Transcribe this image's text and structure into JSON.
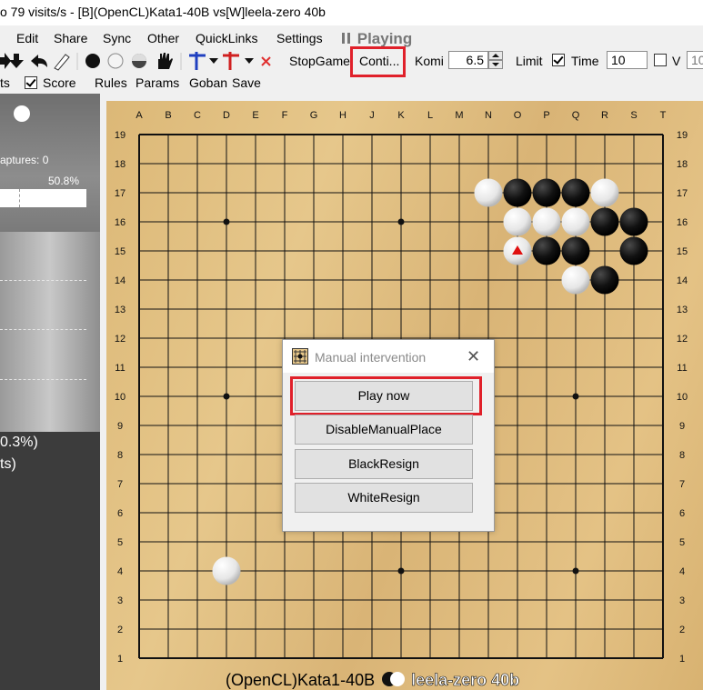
{
  "window": {
    "title": "o 79 visits/s - [B](OpenCL)Kata1-40B vs[W]leela-zero 40b"
  },
  "menu": {
    "items": [
      "Edit",
      "Share",
      "Sync",
      "Other",
      "QuickLinks",
      "Settings"
    ],
    "status": "Playing"
  },
  "toolbar": {
    "stop_game": "StopGame",
    "continue": "Conti...",
    "komi_label": "Komi",
    "komi_value": "6.5",
    "limit_label": "Limit",
    "time_label": "Time",
    "time_value": "10",
    "v_label": "V",
    "v_value": "10",
    "time_checked": true,
    "v_checked": false
  },
  "toolbar2": {
    "items": [
      "ts",
      "Score",
      "Rules",
      "Params",
      "Goban",
      "Save"
    ],
    "score_checked": true
  },
  "left_panel": {
    "captures": "aptures: 0",
    "winrate": "50.8%",
    "stat_line1": "0.3%)",
    "stat_line2": "ts)"
  },
  "board": {
    "columns": [
      "A",
      "B",
      "C",
      "D",
      "E",
      "F",
      "G",
      "H",
      "J",
      "K",
      "L",
      "M",
      "N",
      "O",
      "P",
      "Q",
      "R",
      "S",
      "T"
    ],
    "rows": [
      "19",
      "18",
      "17",
      "16",
      "15",
      "14",
      "13",
      "12",
      "11",
      "10",
      "9",
      "8",
      "7",
      "6",
      "5",
      "4",
      "3",
      "2",
      "1"
    ],
    "hoshi": [
      "D16",
      "K16",
      "D10",
      "Q10",
      "D4",
      "K4",
      "Q4"
    ],
    "stones": [
      {
        "pos": "N17",
        "color": "white"
      },
      {
        "pos": "O17",
        "color": "black"
      },
      {
        "pos": "P17",
        "color": "black"
      },
      {
        "pos": "Q17",
        "color": "black"
      },
      {
        "pos": "R17",
        "color": "white"
      },
      {
        "pos": "O16",
        "color": "white"
      },
      {
        "pos": "P16",
        "color": "white"
      },
      {
        "pos": "Q16",
        "color": "white"
      },
      {
        "pos": "R16",
        "color": "black"
      },
      {
        "pos": "S16",
        "color": "black"
      },
      {
        "pos": "O15",
        "color": "white",
        "last_move": true
      },
      {
        "pos": "P15",
        "color": "black"
      },
      {
        "pos": "Q15",
        "color": "black"
      },
      {
        "pos": "S15",
        "color": "black"
      },
      {
        "pos": "Q14",
        "color": "white"
      },
      {
        "pos": "R14",
        "color": "black"
      },
      {
        "pos": "D4",
        "color": "white"
      }
    ],
    "last_move_color": "#e01010"
  },
  "dialog": {
    "title": "Manual intervention",
    "close": "✕",
    "buttons": [
      "Play now",
      "DisableManualPlace",
      "BlackResign",
      "WhiteResign"
    ]
  },
  "status": {
    "black_player": "(OpenCL)Kata1-40B",
    "white_player": "leela-zero 40b"
  },
  "colors": {
    "highlight": "#e0202a",
    "board": "#e0bf82"
  }
}
